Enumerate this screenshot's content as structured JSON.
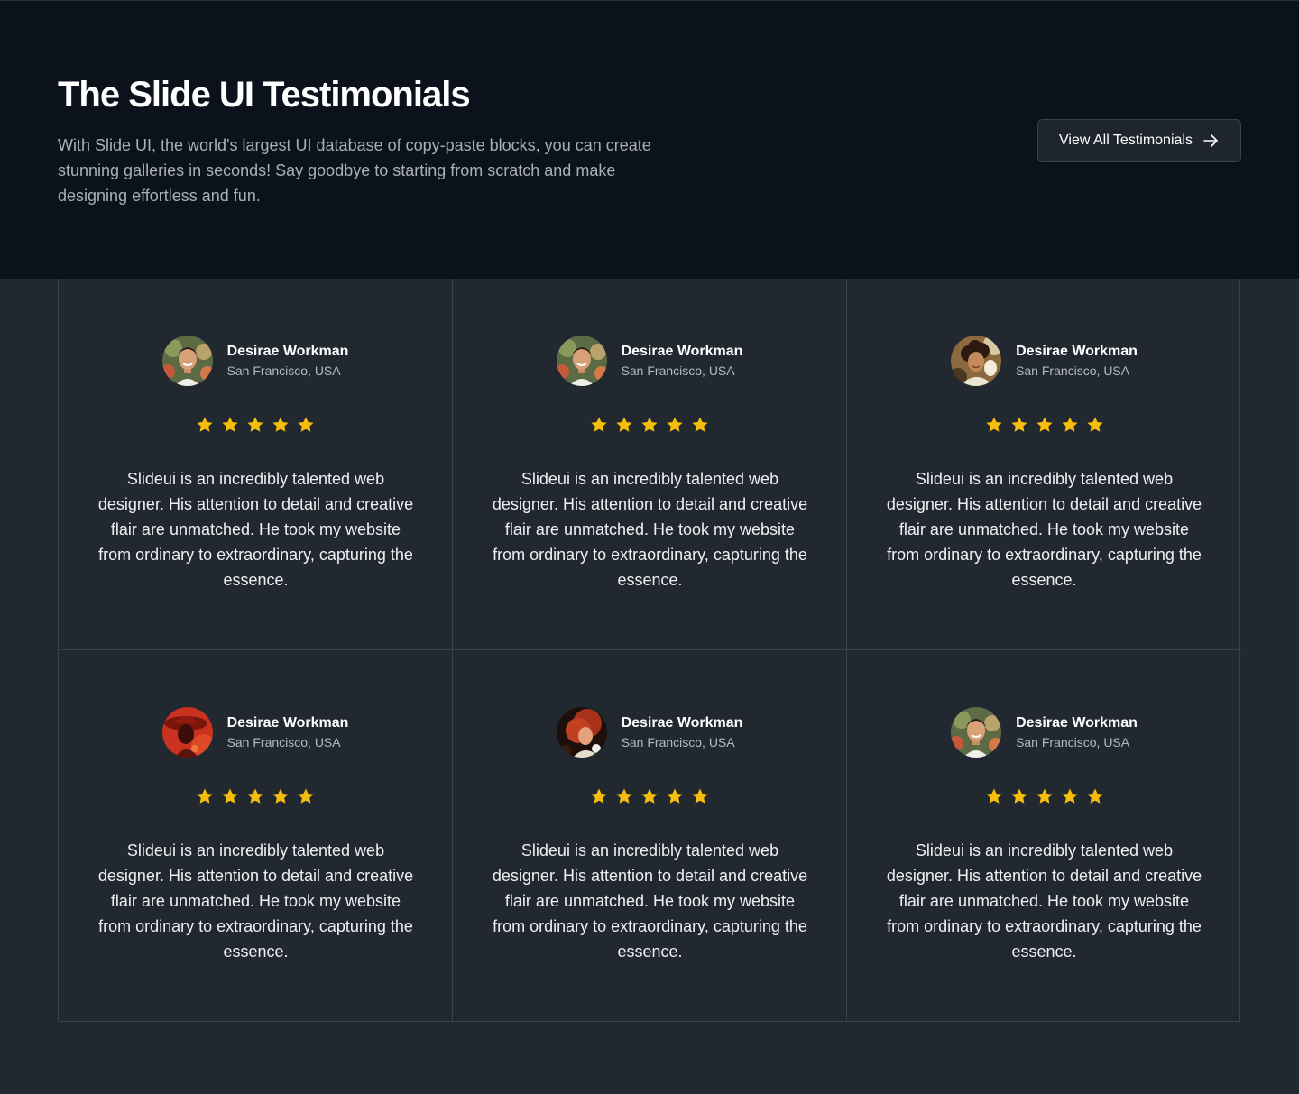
{
  "hero": {
    "title": "The Slide UI Testimonials",
    "description": "With Slide UI, the world's largest UI database of copy-paste blocks, you can create stunning galleries in seconds! Say goodbye to starting from scratch and make designing effortless and fun.",
    "cta_label": "View All Testimonials",
    "cta_icon": "arrow-right-icon"
  },
  "colors": {
    "hero_background": "#0c121c",
    "page_background": "#222830",
    "border": "#3a414b",
    "star": "#f5bd0c"
  },
  "rating_icon": "star-icon",
  "testimonials": [
    {
      "name": "Desirae Workman",
      "location": "San Francisco, USA",
      "rating": 5,
      "avatar": "smiling-man-avatar",
      "quote": "Slideui is an incredibly talented web designer. His attention to detail and creative flair are unmatched. He took my website from ordinary to extraordinary, capturing the essence."
    },
    {
      "name": "Desirae Workman",
      "location": "San Francisco, USA",
      "rating": 5,
      "avatar": "smiling-man-avatar",
      "quote": "Slideui is an incredibly talented web designer. His attention to detail and creative flair are unmatched. He took my website from ordinary to extraordinary, capturing the essence."
    },
    {
      "name": "Desirae Workman",
      "location": "San Francisco, USA",
      "rating": 5,
      "avatar": "curly-hair-woman-avatar",
      "quote": "Slideui is an incredibly talented web designer. His attention to detail and creative flair are unmatched. He took my website from ordinary to extraordinary, capturing the essence."
    },
    {
      "name": "Desirae Workman",
      "location": "San Francisco, USA",
      "rating": 5,
      "avatar": "red-hat-woman-avatar",
      "quote": "Slideui is an incredibly talented web designer. His attention to detail and creative flair are unmatched. He took my website from ordinary to extraordinary, capturing the essence."
    },
    {
      "name": "Desirae Workman",
      "location": "San Francisco, USA",
      "rating": 5,
      "avatar": "red-hair-woman-avatar",
      "quote": "Slideui is an incredibly talented web designer. His attention to detail and creative flair are unmatched. He took my website from ordinary to extraordinary, capturing the essence."
    },
    {
      "name": "Desirae Workman",
      "location": "San Francisco, USA",
      "rating": 5,
      "avatar": "smiling-man-avatar",
      "quote": "Slideui is an incredibly talented web designer. His attention to detail and creative flair are unmatched. He took my website from ordinary to extraordinary, capturing the essence."
    }
  ]
}
